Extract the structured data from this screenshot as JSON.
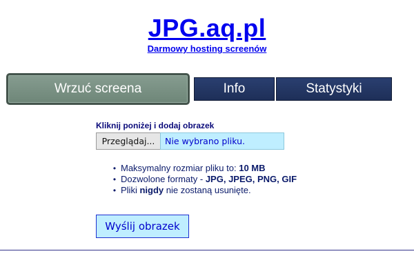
{
  "header": {
    "title": "JPG.aq.pl",
    "subtitle": "Darmowy hosting screenów"
  },
  "nav": {
    "tabs": [
      {
        "label": "Wrzuć screena",
        "active": true
      },
      {
        "label": "Info",
        "active": false
      },
      {
        "label": "Statystyki",
        "active": false
      }
    ]
  },
  "upload": {
    "heading": "Kliknij poniżej i dodaj obrazek",
    "browse_label": "Przeglądaj...",
    "file_status": "Nie wybrano pliku.",
    "rules": [
      {
        "prefix": "Maksymalny rozmiar pliku to: ",
        "bold": "10 MB",
        "suffix": ""
      },
      {
        "prefix": "Dozwolone formaty - ",
        "bold": "JPG, JPEG, PNG, GIF",
        "suffix": ""
      },
      {
        "prefix": "Pliki ",
        "bold": "nigdy",
        "suffix": " nie zostaną usunięte."
      }
    ],
    "submit_label": "Wyślij obrazek"
  },
  "colors": {
    "link": "#0000ee",
    "active_tab": "#7a9284",
    "inactive_tab": "#243766",
    "input_bg": "#bfeeff"
  }
}
